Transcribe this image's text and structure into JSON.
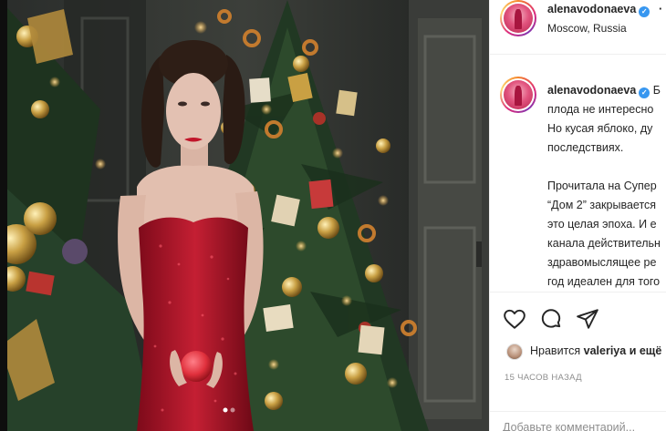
{
  "post": {
    "username": "alenavodonaeva",
    "location": "Moscow, Russia",
    "caption_lines": [
      "Б",
      "плода не интересно",
      "Но кусая яблоко, ду",
      "последствиях.",
      "",
      "Прочитала на Супер",
      "“Дом 2” закрывается",
      "это целая эпоха. И е",
      "канала действительн",
      "здравомыслящее ре",
      "год идеален для того"
    ],
    "likes_prefix": "Нравится ",
    "likes_user": "valeriya",
    "likes_suffix": " и ещё",
    "timestamp": "15 ЧАСОВ НАЗАД",
    "comment_placeholder": "Добавьте комментарий..."
  },
  "icons": {
    "like": "heart-icon",
    "comment": "comment-bubble-icon",
    "share": "paper-plane-icon",
    "verified": "verified-badge-icon",
    "more": "more-dots-icon"
  },
  "colors": {
    "text": "#262626",
    "secondary": "#8e8e8e",
    "verified": "#3897f0",
    "dress": "#b5122a",
    "apple": "#e0303c"
  }
}
